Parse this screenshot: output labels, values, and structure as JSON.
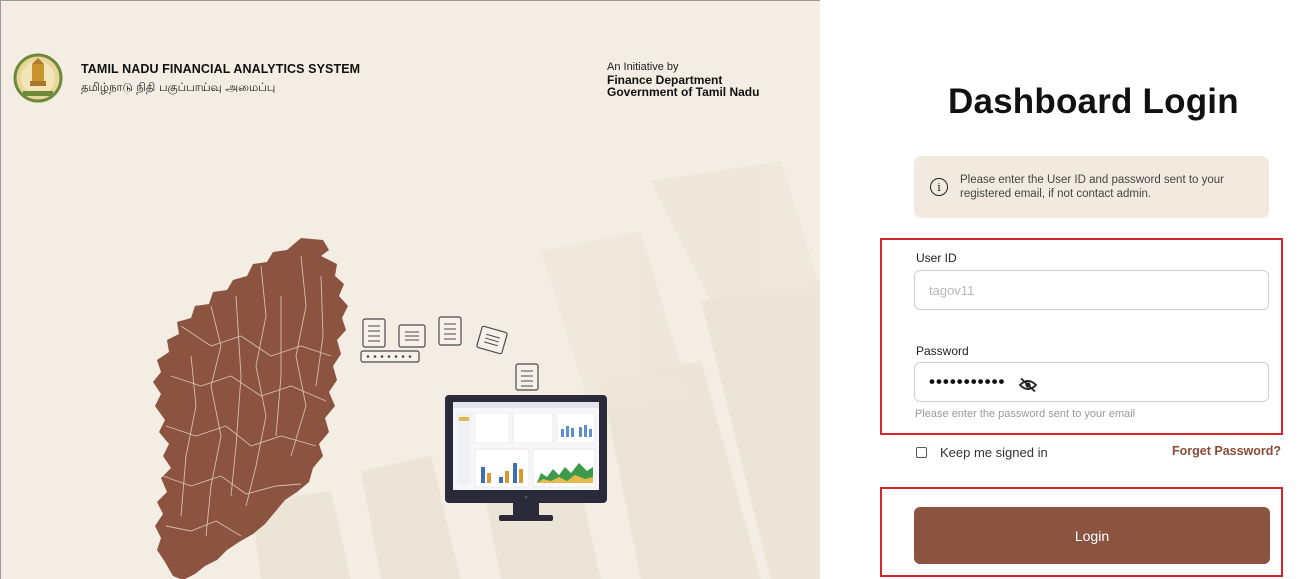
{
  "brand": {
    "title_en": "TAMIL NADU FINANCIAL ANALYTICS SYSTEM",
    "title_ta": "தமிழ்நாடு நிதி பகுப்பாய்வு அமைப்பு",
    "emblem_icon": "tamil-nadu-emblem-icon"
  },
  "initiative": {
    "label": "An Initiative by",
    "department": "Finance Department",
    "government": "Government of Tamil Nadu"
  },
  "login": {
    "title": "Dashboard Login",
    "info_text": "Please enter the User ID and password sent to your registered email, if not contact admin.",
    "user_id_label": "User ID",
    "user_id_value": "tagov11",
    "password_label": "Password",
    "password_value": "•••••••••••",
    "password_hint": "Please enter the password sent to your email",
    "keep_signed_in_label": "Keep me signed in",
    "keep_signed_in_checked": false,
    "forgot_label": "Forget Password?",
    "login_button": "Login"
  },
  "colors": {
    "hero_bg": "#f4ede3",
    "map_fill": "#8b5340",
    "accent": "#8b5340",
    "highlight": "#d6262c"
  }
}
